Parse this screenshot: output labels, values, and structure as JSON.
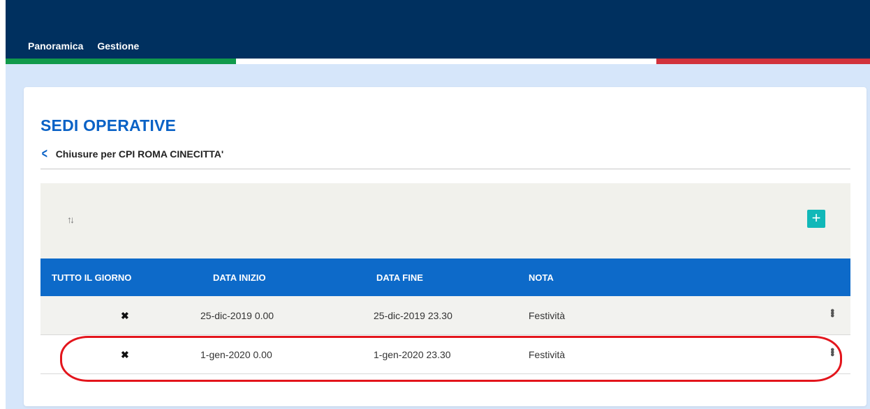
{
  "nav": {
    "items": [
      "Panoramica",
      "Gestione"
    ]
  },
  "colors": {
    "nav_bg": "#00305f",
    "flag_green": "#119a4b",
    "flag_red": "#d1323c",
    "accent": "#0a62c6",
    "header_bg": "#0d6ac9",
    "add_button": "#11b8b8"
  },
  "page": {
    "title": "SEDI OPERATIVE",
    "breadcrumb": "Chiusure per CPI ROMA CINECITTA'"
  },
  "toolbar": {
    "sort_icon": "sort-icon",
    "add_icon": "plus-icon"
  },
  "table": {
    "columns": [
      "TUTTO IL GIORNO",
      "DATA INIZIO",
      "DATA FINE",
      "NOTA"
    ],
    "rows": [
      {
        "all_day": "✖",
        "start": "25-dic-2019 0.00",
        "end": "25-dic-2019 23.30",
        "note": "Festività"
      },
      {
        "all_day": "✖",
        "start": "1-gen-2020 0.00",
        "end": "1-gen-2020 23.30",
        "note": "Festività"
      }
    ]
  }
}
